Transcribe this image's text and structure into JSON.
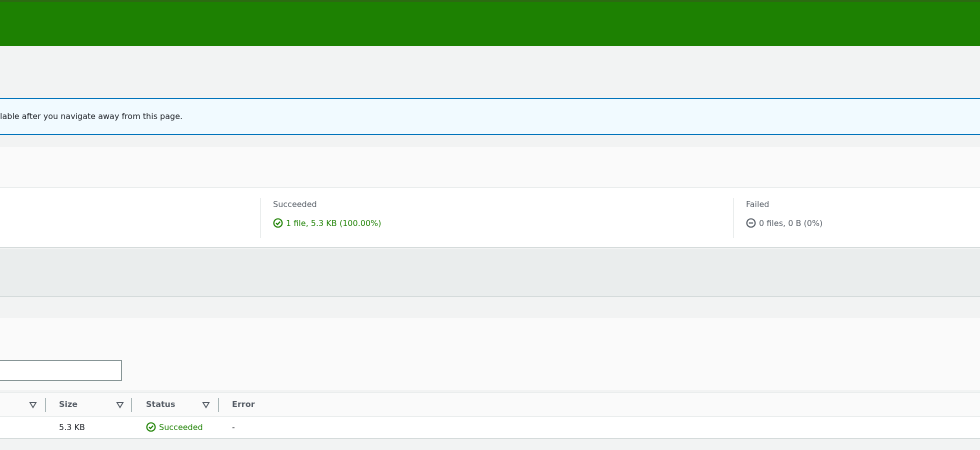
{
  "banner": {
    "info_text": "lable after you navigate away from this page."
  },
  "summary": {
    "succeeded_label": "Succeeded",
    "succeeded_value": "1 file, 5.3 KB (100.00%)",
    "failed_label": "Failed",
    "failed_value": "0 files, 0 B (0%)"
  },
  "files_table": {
    "filter_value": "",
    "columns": [
      "Size",
      "Status",
      "Error"
    ],
    "rows": [
      {
        "size": "5.3 KB",
        "status": "Succeeded",
        "error": "-"
      }
    ]
  },
  "colors": {
    "success": "#1d8102",
    "info_border": "#0073bb",
    "info_bg": "#f1faff"
  },
  "icons": {
    "success": "check-circle-icon",
    "failed": "minus-circle-icon",
    "sort": "sort-down-icon"
  }
}
